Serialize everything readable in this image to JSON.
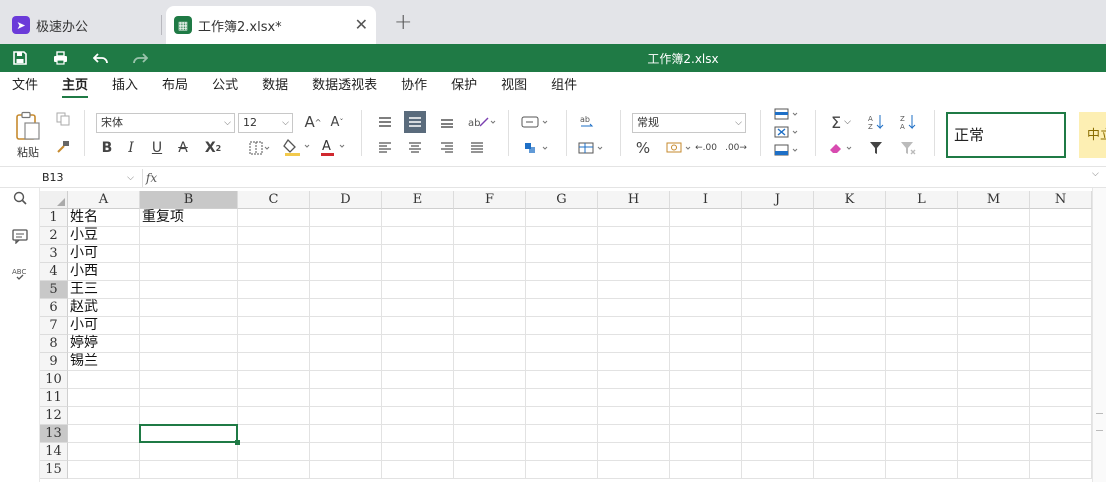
{
  "tabs": {
    "home_label": "极速办公",
    "file_label": "工作簿2.xlsx*",
    "close_glyph": "✕",
    "new_tab_glyph": "+"
  },
  "title_bar": {
    "document_title": "工作簿2.xlsx"
  },
  "menu": {
    "items": [
      "文件",
      "主页",
      "插入",
      "布局",
      "公式",
      "数据",
      "数据透视表",
      "协作",
      "保护",
      "视图",
      "组件"
    ],
    "active": "主页"
  },
  "ribbon": {
    "paste_label": "粘贴",
    "font_name": "宋体",
    "font_size": "12",
    "number_format": "常规",
    "style_normal": "正常",
    "style_mid": "中立"
  },
  "formula_bar": {
    "cell_ref": "B13",
    "fx_label": "fx",
    "content": ""
  },
  "grid": {
    "columns": [
      "A",
      "B",
      "C",
      "D",
      "E",
      "F",
      "G",
      "H",
      "I",
      "J",
      "K",
      "L",
      "M",
      "N"
    ],
    "rows": [
      "1",
      "2",
      "3",
      "4",
      "5",
      "6",
      "7",
      "8",
      "9",
      "10",
      "11",
      "12",
      "13",
      "14",
      "15"
    ],
    "selected_column": "B",
    "selected_row": "13",
    "highlighted_row_header": "5",
    "cells": {
      "A1": "姓名",
      "B1": "重复项",
      "A2": "小豆",
      "A3": "小可",
      "A4": "小西",
      "A5": "王三",
      "A6": "赵武",
      "A7": "小可",
      "A8": "婷婷",
      "A9": "锡兰"
    }
  },
  "accent_color": "#1f7a45"
}
